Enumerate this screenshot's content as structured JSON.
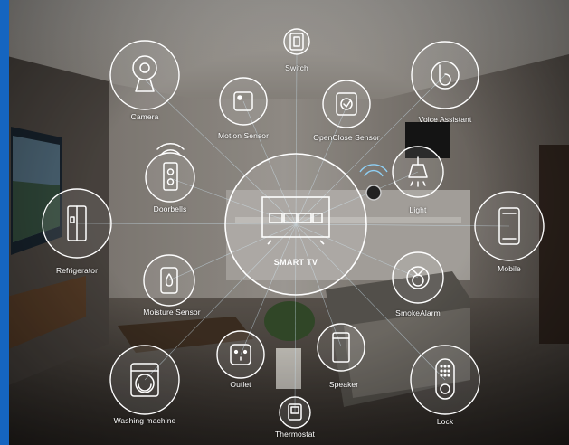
{
  "hub": {
    "label": "SMART TV",
    "icon": "tv-icon"
  },
  "devices": {
    "switch": {
      "label": "Switch",
      "icon": "switch-icon"
    },
    "camera": {
      "label": "Camera",
      "icon": "camera-icon"
    },
    "motion_sensor": {
      "label": "Motion Sensor",
      "icon": "motion-sensor-icon"
    },
    "openclose_sensor": {
      "label": "OpenClose Sensor",
      "icon": "openclose-sensor-icon"
    },
    "voice_assistant": {
      "label": "Voice Assistant",
      "icon": "voice-assistant-icon"
    },
    "doorbells": {
      "label": "Doorbells",
      "icon": "doorbell-icon"
    },
    "light": {
      "label": "Light",
      "icon": "light-icon"
    },
    "refrigerator": {
      "label": "Refrigerator",
      "icon": "refrigerator-icon"
    },
    "mobile": {
      "label": "Mobile",
      "icon": "mobile-icon"
    },
    "moisture_sensor": {
      "label": "Moisture Sensor",
      "icon": "moisture-sensor-icon"
    },
    "smoke_alarm": {
      "label": "SmokeAlarm",
      "icon": "smoke-alarm-icon"
    },
    "outlet": {
      "label": "Outlet",
      "icon": "outlet-icon"
    },
    "speaker": {
      "label": "Speaker",
      "icon": "speaker-icon"
    },
    "washing_machine": {
      "label": "Washing machine",
      "icon": "washing-machine-icon"
    },
    "lock": {
      "label": "Lock",
      "icon": "lock-icon"
    },
    "thermostat": {
      "label": "Thermostat",
      "icon": "thermostat-icon"
    }
  },
  "colors": {
    "accent_bar": "#1565c0",
    "icon_stroke": "#ffffff"
  }
}
